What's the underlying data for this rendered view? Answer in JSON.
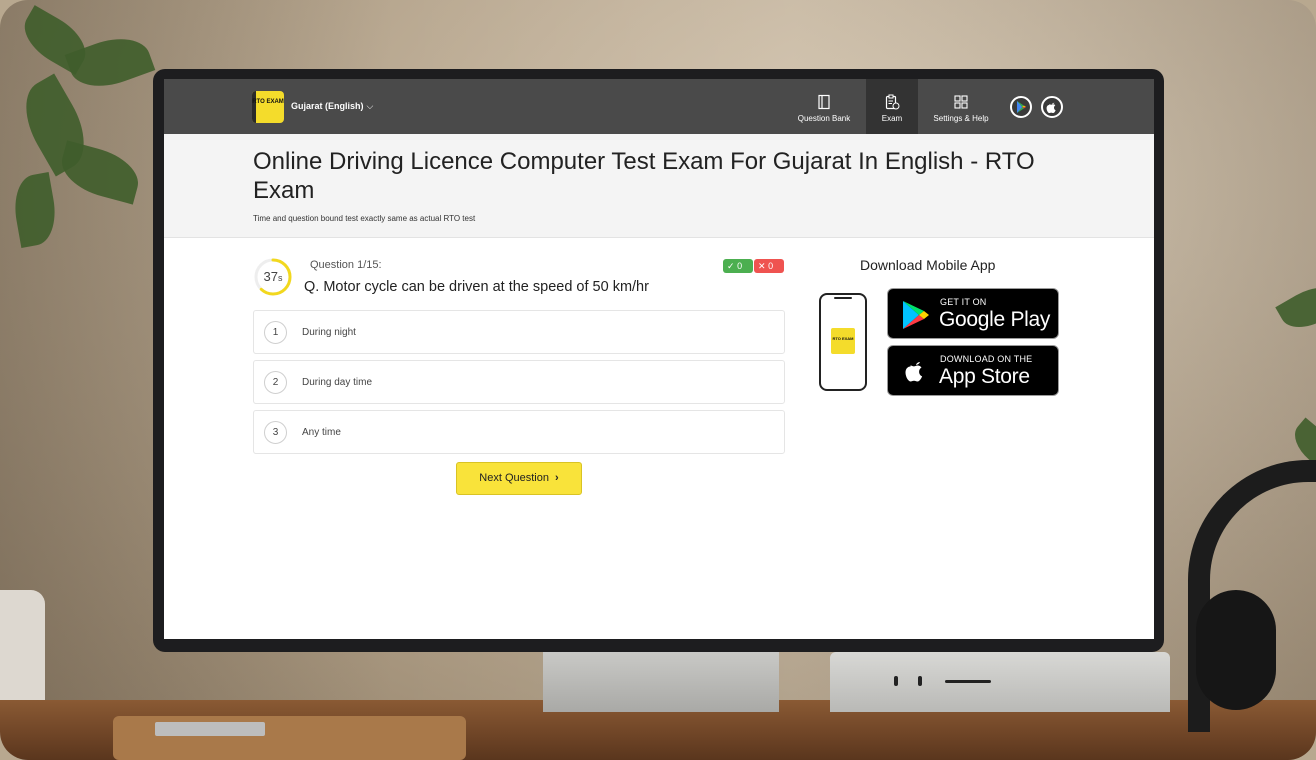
{
  "header": {
    "brand_logo_text": "RTO EXAM",
    "state_selector": "Gujarat (English)",
    "nav": [
      {
        "label": "Question Bank",
        "icon": "book-icon"
      },
      {
        "label": "Exam",
        "icon": "exam-clipboard-icon",
        "active": true
      },
      {
        "label": "Settings & Help",
        "icon": "grid-icon"
      }
    ],
    "store_icons": [
      "google-play-icon",
      "apple-icon"
    ]
  },
  "page": {
    "title": "Online Driving Licence Computer Test Exam For Gujarat In English - RTO Exam",
    "subtitle": "Time and question bound test exactly same as actual RTO test"
  },
  "quiz": {
    "timer_value": "37",
    "timer_unit": "s",
    "timer_fraction": 0.62,
    "question_count": "Question 1/15:",
    "question": "Q. Motor cycle can be driven at the speed of 50 km/hr",
    "correct_count": "0",
    "wrong_count": "0",
    "options": [
      {
        "number": "1",
        "text": "During night"
      },
      {
        "number": "2",
        "text": "During day time"
      },
      {
        "number": "3",
        "text": "Any time"
      }
    ],
    "next_label": "Next Question"
  },
  "download": {
    "title": "Download Mobile App",
    "phone_logo_text": "RTO EXAM",
    "google_play": {
      "small": "GET IT ON",
      "big": "Google Play"
    },
    "app_store": {
      "small": "DOWNLOAD ON THE",
      "big": "App Store"
    }
  },
  "colors": {
    "nav_bg": "#4a4a4a",
    "brand_yellow": "#f4dc2b",
    "timer_yellow": "#f2d81e",
    "success": "#4caf50",
    "danger": "#ef5350"
  }
}
